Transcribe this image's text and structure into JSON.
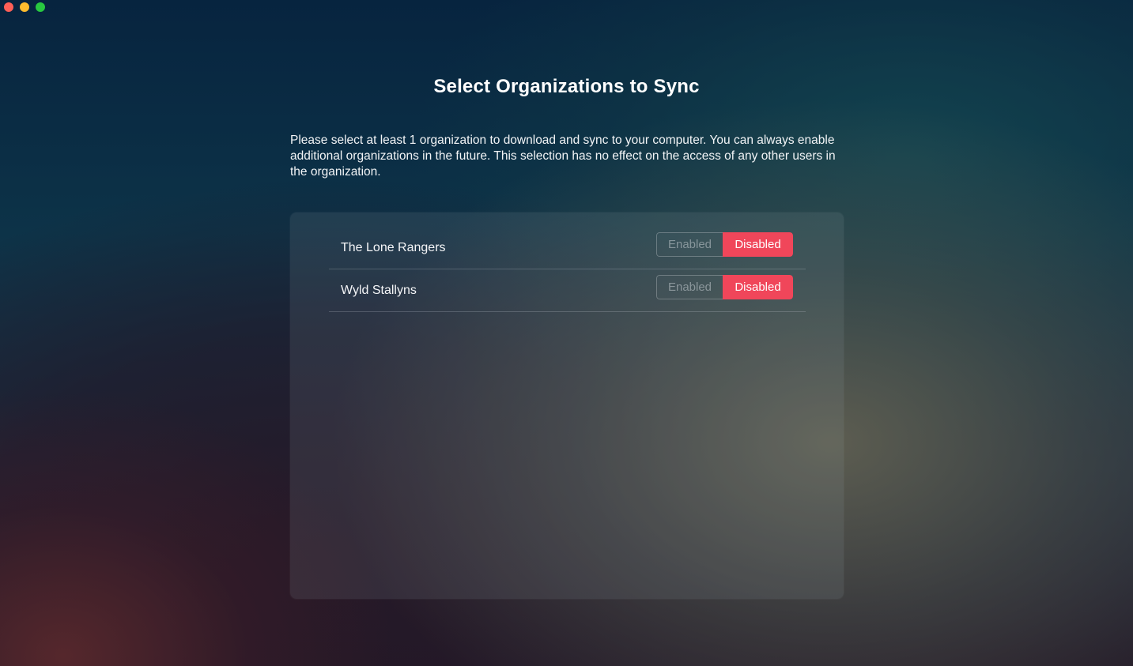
{
  "window": {
    "controls": [
      "close",
      "minimize",
      "maximize"
    ]
  },
  "title": "Select Organizations to Sync",
  "description": "Please select at least 1 organization to download and sync to your computer. You can always enable additional organizations in the future. This selection has no effect on the access of any other users in the organization.",
  "organizations": [
    {
      "name": "The Lone Rangers",
      "enabled_label": "Enabled",
      "disabled_label": "Disabled",
      "state": "Disabled"
    },
    {
      "name": "Wyld Stallyns",
      "enabled_label": "Enabled",
      "disabled_label": "Disabled",
      "state": "Disabled"
    }
  ],
  "colors": {
    "accent": "#f0465a",
    "close": "#fe5f57",
    "minimize": "#febc2e",
    "maximize": "#28c840"
  }
}
